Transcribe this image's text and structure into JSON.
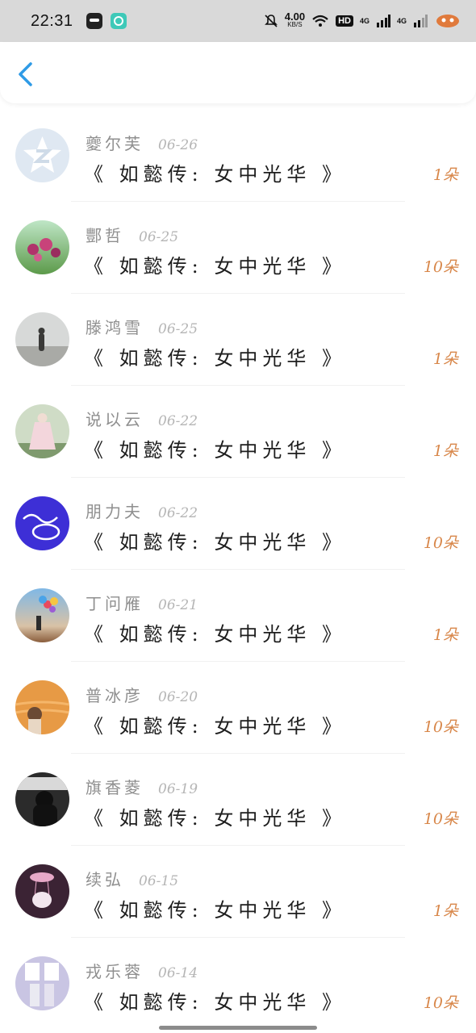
{
  "status": {
    "time": "22:31",
    "speed_value": "4.00",
    "speed_unit": "KB/S",
    "hd": "HD",
    "net1": "4G",
    "net2": "4G"
  },
  "items": [
    {
      "name": "夔尔芙",
      "date": "06-26",
      "title": "《 如懿传: 女中光华 》",
      "flowers": "1朵"
    },
    {
      "name": "酆哲",
      "date": "06-25",
      "title": "《 如懿传: 女中光华 》",
      "flowers": "10朵"
    },
    {
      "name": "滕鸿雪",
      "date": "06-25",
      "title": "《 如懿传: 女中光华 》",
      "flowers": "1朵"
    },
    {
      "name": "说以云",
      "date": "06-22",
      "title": "《 如懿传: 女中光华 》",
      "flowers": "1朵"
    },
    {
      "name": "朋力夫",
      "date": "06-22",
      "title": "《 如懿传: 女中光华 》",
      "flowers": "10朵"
    },
    {
      "name": "丁问雁",
      "date": "06-21",
      "title": "《 如懿传: 女中光华 》",
      "flowers": "1朵"
    },
    {
      "name": "普冰彦",
      "date": "06-20",
      "title": "《 如懿传: 女中光华 》",
      "flowers": "10朵"
    },
    {
      "name": "旗香菱",
      "date": "06-19",
      "title": "《 如懿传: 女中光华 》",
      "flowers": "10朵"
    },
    {
      "name": "续弘",
      "date": "06-15",
      "title": "《 如懿传: 女中光华 》",
      "flowers": "1朵"
    },
    {
      "name": "戎乐蓉",
      "date": "06-14",
      "title": "《 如懿传: 女中光华 》",
      "flowers": "10朵"
    }
  ]
}
